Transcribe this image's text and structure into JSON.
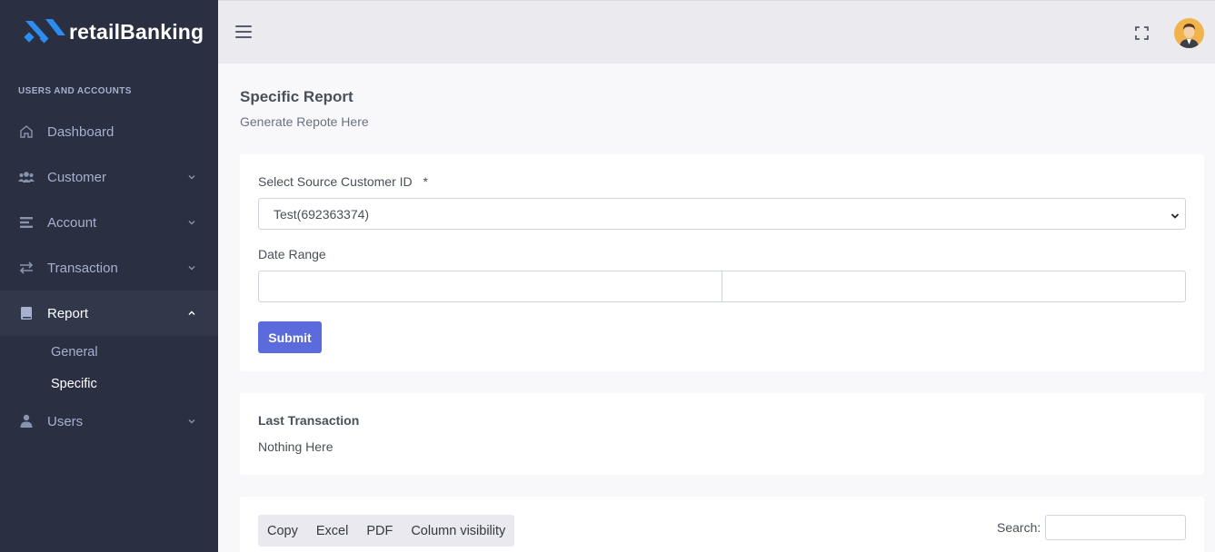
{
  "brand": {
    "name": "retailBanking"
  },
  "sidebar": {
    "menu_title": "USERS AND ACCOUNTS",
    "items": [
      {
        "label": "Dashboard",
        "icon": "home-icon"
      },
      {
        "label": "Customer",
        "icon": "users-icon"
      },
      {
        "label": "Account",
        "icon": "list-icon"
      },
      {
        "label": "Transaction",
        "icon": "transfer-icon"
      },
      {
        "label": "Report",
        "icon": "book-icon"
      },
      {
        "label": "Users",
        "icon": "user-tie-icon"
      }
    ],
    "report_sub": [
      {
        "label": "General"
      },
      {
        "label": "Specific"
      }
    ]
  },
  "page": {
    "title": "Specific Report",
    "subtitle": "Generate Repote Here"
  },
  "form": {
    "customer_label": "Select Source Customer ID",
    "required_mark": "*",
    "customer_value": "Test(692363374)",
    "date_label": "Date Range",
    "submit_label": "Submit"
  },
  "last_transaction": {
    "title": "Last Transaction",
    "text": "Nothing Here"
  },
  "table_tools": {
    "buttons": [
      "Copy",
      "Excel",
      "PDF",
      "Column visibility"
    ],
    "search_label": "Search:"
  },
  "colors": {
    "sidebar_bg": "#2a3042",
    "accent": "#5b6bdc",
    "logo_blue": "#2d8cf0",
    "avatar_bg": "#f1b44c"
  }
}
